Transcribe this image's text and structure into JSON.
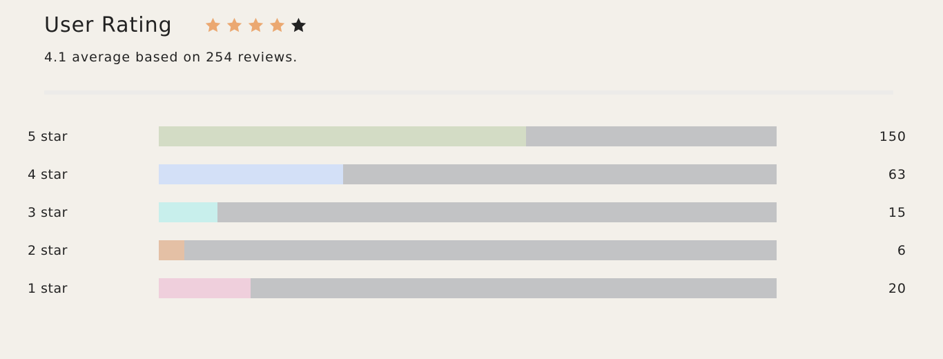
{
  "header": {
    "title": "User Rating",
    "rating_stars": {
      "filled": 4,
      "total": 5,
      "filled_color": "#eba871",
      "empty_color": "#222222"
    }
  },
  "summary": "4.1 average based on 254 reviews.",
  "rows": [
    {
      "label": "5 star",
      "count": "150",
      "fill_fraction": 0.594,
      "color": "#d3dcc5"
    },
    {
      "label": "4 star",
      "count": "63",
      "fill_fraction": 0.298,
      "color": "#d3e0f7"
    },
    {
      "label": "3 star",
      "count": "15",
      "fill_fraction": 0.095,
      "color": "#c8efec"
    },
    {
      "label": "2 star",
      "count": "6",
      "fill_fraction": 0.041,
      "color": "#e4c0a5"
    },
    {
      "label": "1 star",
      "count": "20",
      "fill_fraction": 0.149,
      "color": "#efcfdc"
    }
  ]
}
